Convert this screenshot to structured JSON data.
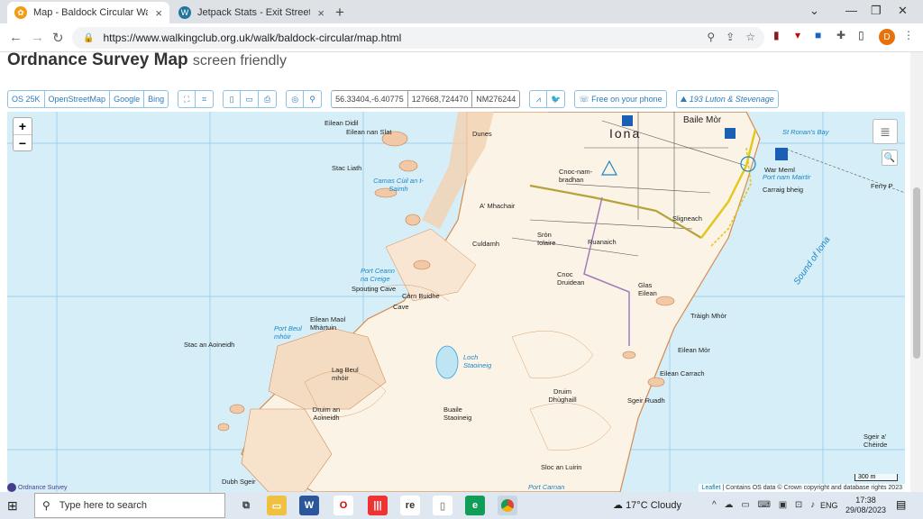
{
  "browser": {
    "tabs": [
      {
        "title": "Map - Baldock Circular Walk - SW",
        "active": true
      },
      {
        "title": "Jetpack Stats - Exit Street View —",
        "active": false
      }
    ],
    "url": "https://www.walkingclub.org.uk/walk/baldock-circular/map.html",
    "profile_initial": "D"
  },
  "page": {
    "title": "Ordnance Survey Map",
    "subtitle": "screen friendly"
  },
  "toolbar": {
    "os25k": "OS 25K",
    "osm": "OpenStreetMap",
    "google": "Google",
    "bing": "Bing",
    "coords": "56.33404,-6.40775",
    "grid": "127668,724470",
    "gridref": "NM276244",
    "free_phone": "Free on your phone",
    "walk_link": "193 Luton & Stevenage"
  },
  "map": {
    "zoom_in": "+",
    "zoom_out": "−",
    "attribution_leaflet": "Leaflet",
    "attribution_text": " | Contains OS data © Crown copyright and database rights 2023",
    "scale": "300 m",
    "os_logo": "Ordnance Survey",
    "labels": {
      "iona": "Iona",
      "baile_mor": "Baile Mòr",
      "sound_of_iona": "Sound of Iona",
      "camas_cuil": "Camas Cùil an t-Saimh",
      "port_nam_mairtir": "Port nam Mairtir",
      "st_ronans_bay": "St Ronan's Bay",
      "war_meml": "War Meml",
      "carraig_bheig": "Carraig bheig",
      "ferry": "Ferry P",
      "eilean_didil": "Eilean Didil",
      "eilean_nan_slat": "Eilean nan Slat",
      "stac_liath": "Stac Liath",
      "a_mhachair": "A' Mhachair",
      "culdamh": "Culdamh",
      "sron_iolaire": "Sròn Iolaire",
      "ruanaich": "Ruanaich",
      "sligneach": "Sligneach",
      "cnoc_druidean": "Cnoc Druidean",
      "port_ceann": "Port Ceann na Creige",
      "spouting_cave": "Spouting Cave",
      "carn_buidhe": "Càrn Buidhe",
      "cave": "Cave",
      "eilean_maol": "Eilean Maol Mhàrtuin",
      "stac_an_aoineidh": "Stac an Aoineidh",
      "lag_beul": "Lag Beul mhòir",
      "loch_staoineig": "Loch Staoineig",
      "druim_an_aoineidh": "Druim an Aoineidh",
      "buaile_staoineig": "Buaile Staoineig",
      "druim_dhughaill": "Druim Dhùghaill",
      "traigh_mhor": "Tràigh Mhòr",
      "eilean_mor": "Eilean Mòr",
      "eilean_carrach": "Eilean Carrach",
      "sgeir_ruadh": "Sgeir Ruadh",
      "sloc_an_luirin": "Sloc an Luirin",
      "port_carnan": "Port Carnan",
      "dubh_sgeir": "Dubh Sgeir",
      "sgeir_a_cheirde": "Sgeir a' Chèirde",
      "glas_eilean": "Glas Eilean",
      "dunes": "Dunes",
      "cnoc_nam_bradhan": "Cnoc-nam-bradhan",
      "port_beul": "Port Beul mhòir"
    }
  },
  "taskbar": {
    "search_placeholder": "Type here to search",
    "weather": "17°C  Cloudy",
    "lang": "ENG",
    "time": "17:38",
    "date": "29/08/2023"
  }
}
